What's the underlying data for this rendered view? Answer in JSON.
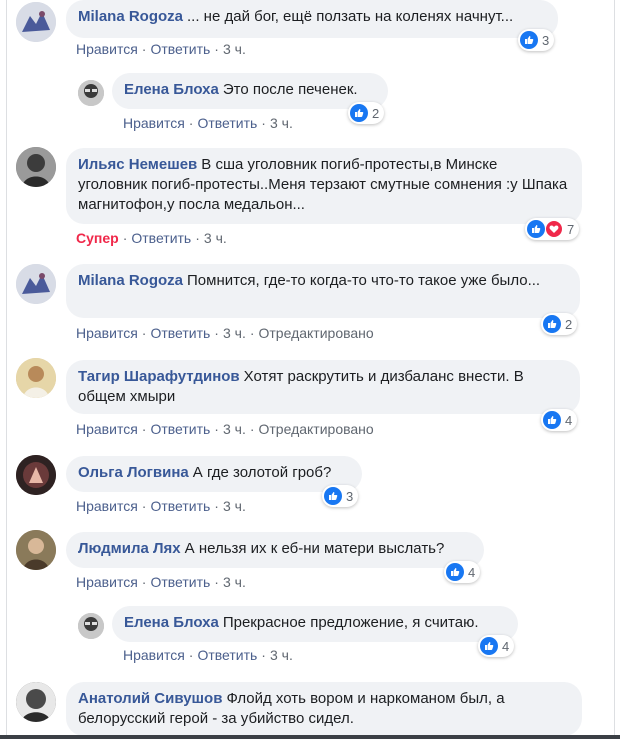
{
  "actions": {
    "like": "Нравится",
    "reply": "Ответить",
    "super": "Супер",
    "edited": "Отредактировано",
    "sep": "·"
  },
  "colors": {
    "author": "#385898",
    "bubble": "#f0f2f5",
    "like_blue": "#1877f2",
    "super_red": "#f0284a",
    "meta_gray": "#606770"
  },
  "comments": [
    {
      "author": "Milana Rogoza",
      "text": "... не дай бог, ещё ползать на коленях начнут...",
      "time": "3 ч.",
      "reactions": "3",
      "reaction_icons": [
        "like-icon"
      ]
    },
    {
      "author": "Елена Блоха",
      "text": "Это после печенек.",
      "time": "3 ч.",
      "reactions": "2",
      "reaction_icons": [
        "like-icon"
      ],
      "reply": true
    },
    {
      "author": "Ильяс Немешев",
      "text": "В сша уголовник погиб-протесты,в Минске уголовник погиб-протесты..Меня терзают смутные сомнения :у Шпака магнитофон,у посла медальон...",
      "time": "3 ч.",
      "reactions": "7",
      "reaction_icons": [
        "like-icon",
        "love-icon"
      ],
      "liked": "Супер"
    },
    {
      "author": "Milana Rogoza",
      "text": "Помнится, где-то когда-то что-то такое уже было...",
      "time": "3 ч.",
      "reactions": "2",
      "reaction_icons": [
        "like-icon"
      ],
      "edited": true
    },
    {
      "author": "Тагир Шарафутдинов",
      "text": "Хотят раскрутить и дизбаланс внести. В общем хмыри",
      "time": "3 ч.",
      "reactions": "4",
      "reaction_icons": [
        "like-icon"
      ],
      "edited": true
    },
    {
      "author": "Ольга Логвина",
      "text": "А где золотой гроб?",
      "time": "3 ч.",
      "reactions": "3",
      "reaction_icons": [
        "like-icon"
      ]
    },
    {
      "author": "Людмила Лях",
      "text": "А нельзя их к еб-ни матери выслать?",
      "time": "3 ч.",
      "reactions": "4",
      "reaction_icons": [
        "like-icon"
      ]
    },
    {
      "author": "Елена Блоха",
      "text": "Прекрасное предложение, я считаю.",
      "time": "3 ч.",
      "reactions": "4",
      "reaction_icons": [
        "like-icon"
      ],
      "reply": true
    },
    {
      "author": "Анатолий Сивушов",
      "text": "Флойд хоть вором и наркоманом был, а белорусский герой - за убийство сидел.",
      "time": "",
      "reactions": "",
      "reaction_icons": []
    }
  ]
}
